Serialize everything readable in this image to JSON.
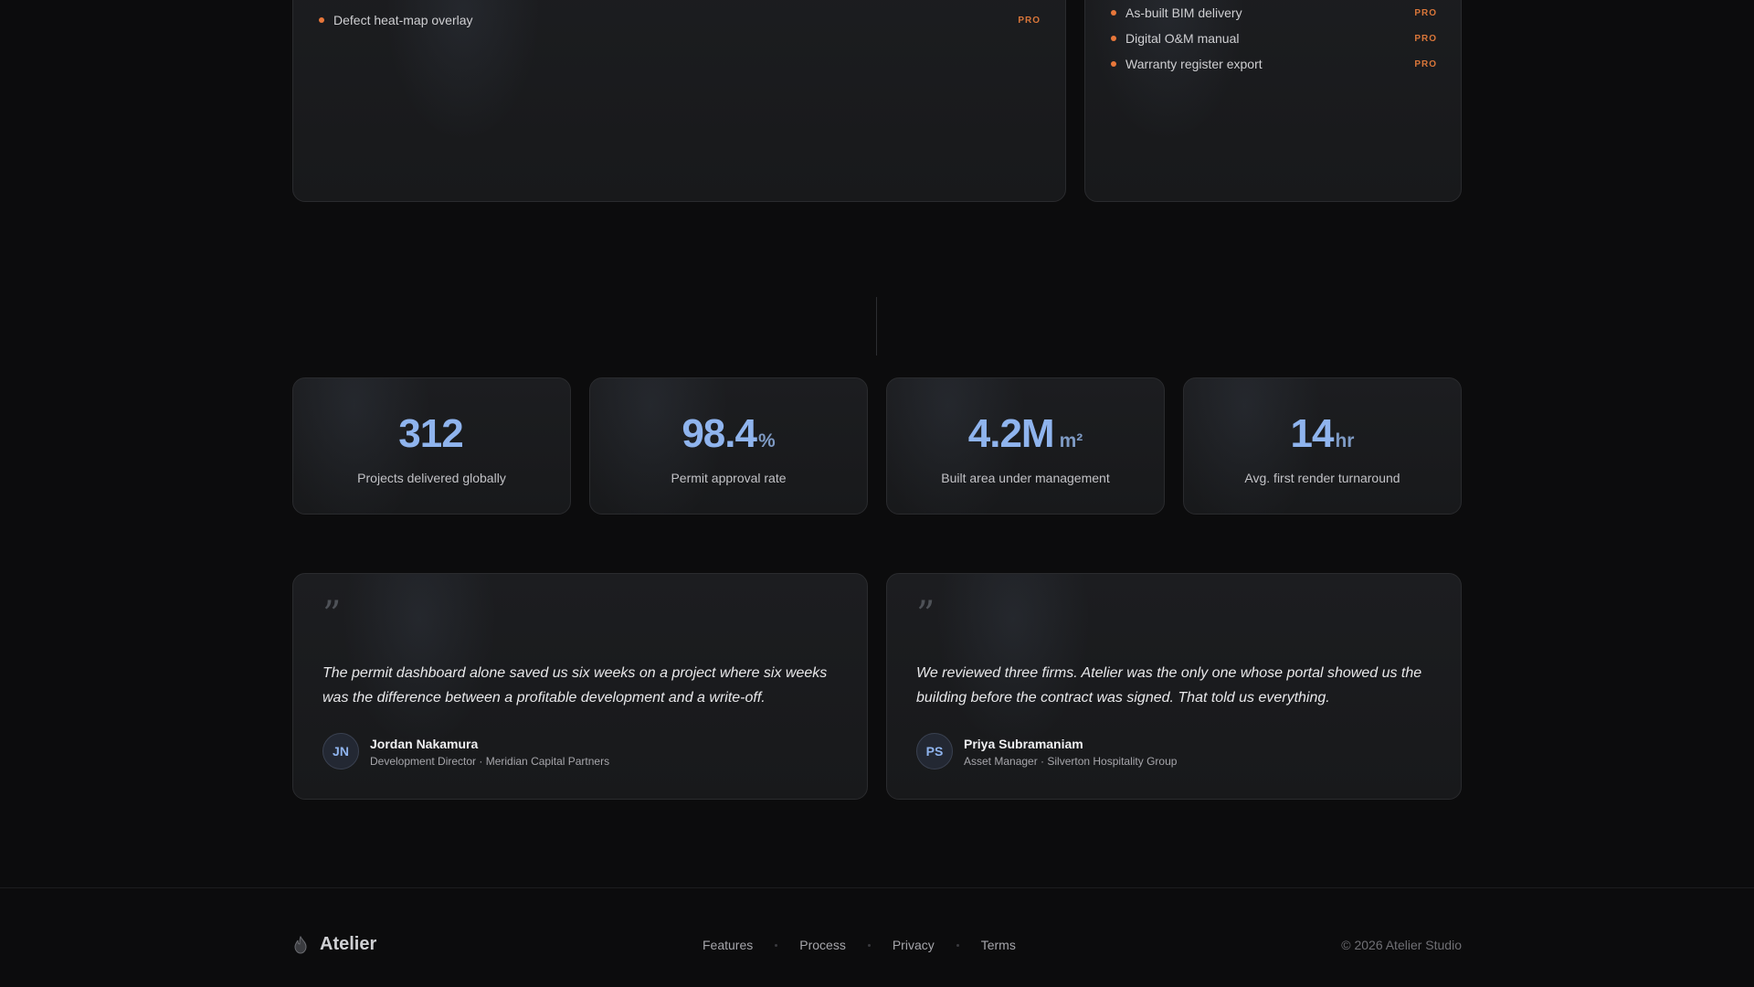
{
  "feature_cards": {
    "left": {
      "items": [
        {
          "label": "Defect heat-map overlay",
          "badge": "PRO"
        }
      ]
    },
    "right": {
      "items": [
        {
          "label": "As-built BIM delivery",
          "badge": "PRO"
        },
        {
          "label": "Digital O&M manual",
          "badge": "PRO"
        },
        {
          "label": "Warranty register export",
          "badge": "PRO"
        }
      ]
    }
  },
  "stats": [
    {
      "value": "312",
      "unit": "",
      "label": "Projects delivered globally"
    },
    {
      "value": "98.4",
      "unit": "%",
      "label": "Permit approval rate"
    },
    {
      "value": "4.2M",
      "unit": "m²",
      "label": "Built area under management"
    },
    {
      "value": "14",
      "unit": "hr",
      "label": "Avg. first render turnaround"
    }
  ],
  "testimonials": [
    {
      "quote_mark": "”",
      "text": "The permit dashboard alone saved us six weeks on a project where six weeks was the difference between a profitable development and a write-off.",
      "initials": "JN",
      "name": "Jordan Nakamura",
      "role": "Development Director · Meridian Capital Partners"
    },
    {
      "quote_mark": "”",
      "text": "We reviewed three firms. Atelier was the only one whose portal showed us the building before the contract was signed. That told us everything.",
      "initials": "PS",
      "name": "Priya Subramaniam",
      "role": "Asset Manager · Silverton Hospitality Group"
    }
  ],
  "footer": {
    "brand": "Atelier",
    "brand_icon": "flame-icon",
    "nav": [
      "Features",
      "Process",
      "Privacy",
      "Terms"
    ],
    "copyright": "© 2026 Atelier Studio"
  },
  "colors": {
    "accent_blue": "#8fb4ee",
    "accent_orange": "#e8773a",
    "background": "#0c0c0d"
  }
}
